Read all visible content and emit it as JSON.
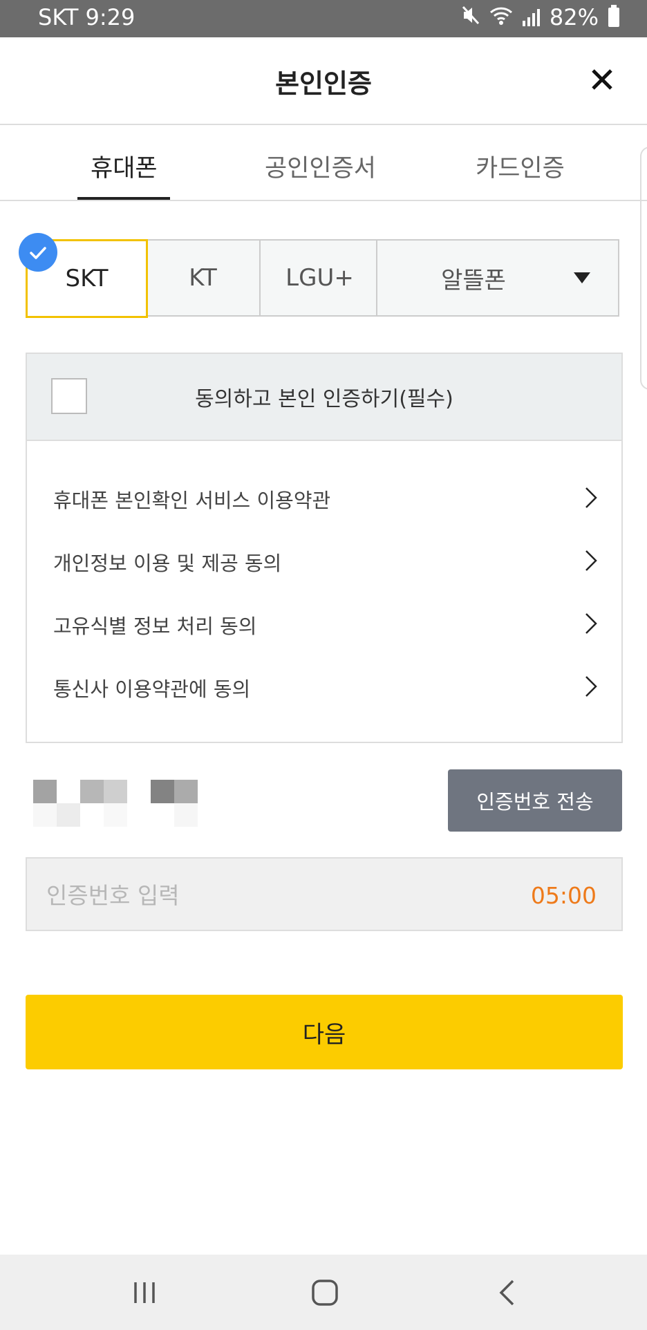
{
  "status_bar": {
    "carrier_time": "SKT 9:29",
    "battery": "82%"
  },
  "header": {
    "title": "본인인증"
  },
  "tabs": [
    {
      "label": "휴대폰",
      "active": true
    },
    {
      "label": "공인인증서",
      "active": false
    },
    {
      "label": "카드인증",
      "active": false
    }
  ],
  "carriers": {
    "options": [
      "SKT",
      "KT",
      "LGU+",
      "알뜰폰"
    ],
    "selected": "SKT"
  },
  "agreement": {
    "all_label": "동의하고 본인 인증하기(필수)",
    "checked": false,
    "terms": [
      "휴대폰 본인확인 서비스 이용약관",
      "개인정보 이용 및 제공 동의",
      "고유식별 정보 처리 동의",
      "통신사 이용약관에 동의"
    ]
  },
  "send_code_button": "인증번호 전송",
  "code_input": {
    "placeholder": "인증번호 입력",
    "timer": "05:00"
  },
  "next_button": "다음",
  "colors": {
    "accent_yellow": "#fccc00",
    "selected_border": "#f2c200",
    "check_blue": "#3d8cf2",
    "timer_orange": "#ee7a1a",
    "send_button_gray": "#6f7580"
  }
}
